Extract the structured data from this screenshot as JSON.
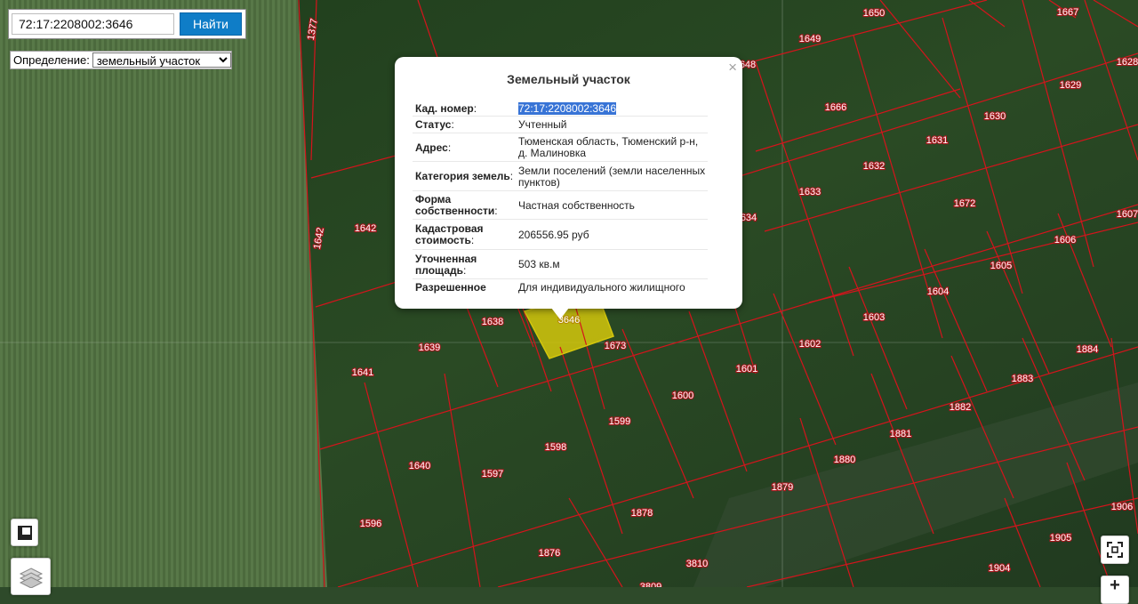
{
  "search": {
    "value": "72:17:2208002:3646",
    "button_label": "Найти"
  },
  "detect": {
    "label": "Определение:",
    "selected": "земельный участок"
  },
  "popup": {
    "title": "Земельный участок",
    "close_label": "×",
    "rows": [
      {
        "key": "Кад. номер",
        "value": "72:17:2208002:3646"
      },
      {
        "key": "Статус",
        "value": "Учтенный"
      },
      {
        "key": "Адрес",
        "value": "Тюменская область, Тюменский р-н, д. Малиновка"
      },
      {
        "key": "Категория земель",
        "value": "Земли поселений (земли населенных пунктов)"
      },
      {
        "key": "Форма собственности",
        "value": "Частная собственность"
      },
      {
        "key": "Кадастровая стоимость",
        "value": "206556.95 руб"
      },
      {
        "key": "Уточненная площадь",
        "value": "503 кв.м"
      },
      {
        "key": "Разрешенное",
        "value": "Для индивидуального жилищного"
      }
    ]
  },
  "map": {
    "boundary_color": "#d5141c",
    "selected_fill": "#d4c70c",
    "selected_label": "3646",
    "plot_labels": [
      "1650",
      "1667",
      "1377",
      "1649",
      "648",
      "1628",
      "1629",
      "1666",
      "1630",
      "1631",
      "1632",
      "1633",
      "1672",
      "1607",
      "634",
      "1642",
      "1642",
      "1606",
      "1605",
      "1604",
      "1603",
      "1638",
      "1673",
      "1602",
      "1884",
      "1639",
      "1641",
      "1601",
      "1600",
      "1883",
      "1599",
      "1882",
      "1881",
      "1598",
      "1880",
      "1640",
      "1597",
      "1879",
      "1878",
      "1596",
      "1906",
      "1905",
      "1876",
      "3810",
      "1904",
      "3809"
    ]
  },
  "controls": {
    "layers_icon": "layers-icon",
    "ruler_icon": "map-frame-icon",
    "fullscreen_icon": "fullscreen-icon",
    "zoom_in_label": "+"
  }
}
